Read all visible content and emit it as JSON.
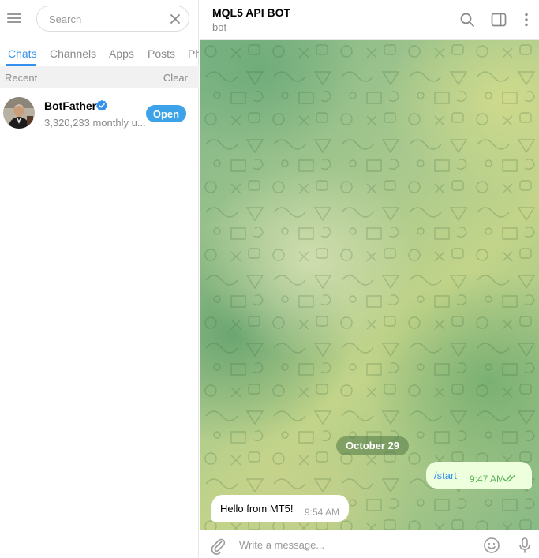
{
  "sidebar": {
    "search_placeholder": "Search",
    "tabs": [
      {
        "label": "Chats",
        "active": true
      },
      {
        "label": "Channels",
        "active": false
      },
      {
        "label": "Apps",
        "active": false
      },
      {
        "label": "Posts",
        "active": false
      },
      {
        "label": "Ph",
        "active": false
      }
    ],
    "recent_label": "Recent",
    "clear_label": "Clear",
    "chats": [
      {
        "name": "BotFather",
        "verified": true,
        "subtitle": "3,320,233 monthly u...",
        "action_label": "Open"
      }
    ]
  },
  "chat": {
    "title": "MQL5 API BOT",
    "status": "bot",
    "date_separator": "October 29",
    "messages": [
      {
        "direction": "out",
        "text": "/start",
        "time": "9:47 AM",
        "read": true
      },
      {
        "direction": "in",
        "text": "Hello from MT5!",
        "time": "9:54 AM"
      }
    ],
    "composer_placeholder": "Write a message..."
  },
  "colors": {
    "accent": "#3390ec",
    "open_button": "#3ca3e8",
    "outgoing_bubble": "#eeffde",
    "read_ticks": "#5fb25a"
  },
  "icons": [
    "menu-icon",
    "close-icon",
    "verified-icon",
    "search-icon",
    "sidebar-toggle-icon",
    "more-vertical-icon",
    "paperclip-icon",
    "emoji-icon",
    "microphone-icon",
    "double-check-icon"
  ]
}
